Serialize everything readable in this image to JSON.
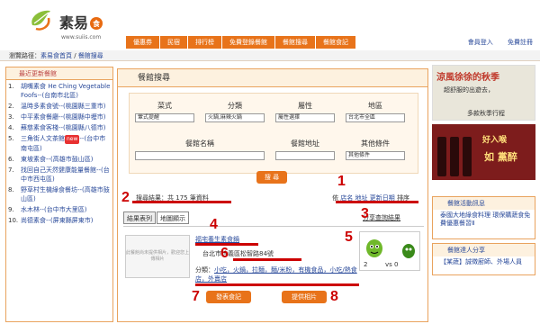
{
  "header": {
    "logo_text": "素易",
    "logo_badge": "食",
    "logo_url": "www.suiis.com",
    "nav": [
      "優惠券",
      "民宿",
      "排行榜",
      "免費登錄餐館",
      "餐館搜尋",
      "餐館食記"
    ],
    "top_links": [
      "會員登入",
      "免費註冊"
    ]
  },
  "breadcrumb": {
    "label": "瀏覽路徑：",
    "items": [
      "素易食首頁",
      "餐館搜尋"
    ],
    "separator": " / "
  },
  "left_panel": {
    "title": "最近更新餐館",
    "items": [
      {
        "num": "1.",
        "text": "胡嘴素食 He Ching Vegetable Foofs--(台南市北區)"
      },
      {
        "num": "2.",
        "text": "溫時多素食號--(桃園縣三重市)"
      },
      {
        "num": "3.",
        "text": "中平素食餐廳--(桃園縣中壢市)"
      },
      {
        "num": "4.",
        "text": "蘇慈素食客棧--(桃園縣八德市)"
      },
      {
        "num": "5.",
        "text": "三角街人文茶館",
        "badge": "new",
        "text2": "--(台中市南屯區)"
      },
      {
        "num": "6.",
        "text": "東坡素食--(高雄市鼓山區)"
      },
      {
        "num": "7.",
        "text": "找回自己天然健康能量餐館--(台中市西屯區)"
      },
      {
        "num": "8.",
        "text": "野草村生機綠食餐坊--(高雄市鼓山區)"
      },
      {
        "num": "9.",
        "text": "水木林--(台中市大里區)"
      },
      {
        "num": "10.",
        "text": "尚德素食--(屏東縣屏東市)"
      }
    ]
  },
  "search": {
    "title": "餐館搜尋",
    "fields": [
      {
        "label": "菜式",
        "value": "葷式提醒"
      },
      {
        "label": "分類",
        "value": "火鍋,麻辣火鍋"
      },
      {
        "label": "屬性",
        "value": "屬性選擇"
      },
      {
        "label": "地區",
        "value": "台北市全區"
      }
    ],
    "fields2": [
      {
        "label": "餐館名稱",
        "value": ""
      },
      {
        "label": "餐館地址",
        "value": ""
      },
      {
        "label": "其他條件",
        "value": "其他條件"
      }
    ],
    "go_label": "搜 尋"
  },
  "results": {
    "summary_prefix": "搜尋結果：共",
    "count": "175",
    "summary_suffix": "筆資料",
    "sort_prefix": "依",
    "sort_links": [
      "店名",
      "地址",
      "更新日期"
    ],
    "sort_suffix": "排序",
    "share_label": "分享查詢結果",
    "tabs": [
      "結果表列",
      "地圖顯示"
    ],
    "item": {
      "name": "福宅養生素食鍋",
      "address": "台北市信義區松智路84號",
      "category_label": "分類：",
      "categories": "小吃，火鍋，拉麵，麵/米粉，有機食品，小吃/熱食店，外賣店",
      "vs_left": "2",
      "vs_text": "vs",
      "vs_right": "0"
    },
    "btn_review": "發表食記",
    "btn_photo": "提供相片",
    "thumb_text": "此餐館尚未提供相片，歡迎您上傳相片"
  },
  "markers": [
    "1",
    "2",
    "3",
    "4",
    "5",
    "6",
    "7",
    "8"
  ],
  "right_panel": {
    "ad1_title": "涼風徐徐的秋季",
    "ad1_sub": "超舒服的出遊去，",
    "ad1_note": "多款秋季行程",
    "ad2_line1": "好入喉",
    "ad2_line2": "如 黨醉",
    "box1_title": "餐館活動訊息",
    "box1_items": [
      "泰國大地綠食料理 環保購蔬食免費優惠餐習Ⅱ"
    ],
    "box2_title": "餐館達人分享",
    "box2_items": [
      "【某蔬】誠徵廚師、外場人員"
    ]
  },
  "colors": {
    "accent": "#e8731a",
    "marker": "#cc0000",
    "link": "#2a4a9a"
  }
}
